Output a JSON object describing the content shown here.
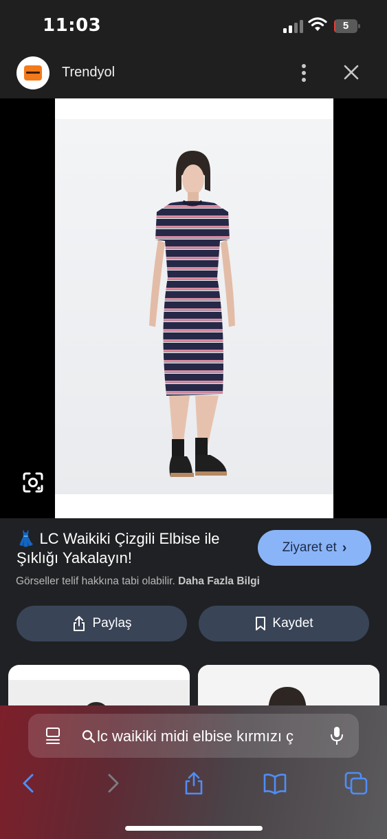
{
  "status_bar": {
    "time": "11:03",
    "battery_level": "5",
    "battery_fraction": 0.05
  },
  "header": {
    "site_name": "Trendyol",
    "logo_text": "trendyol"
  },
  "result": {
    "title": "👗 LC Waikiki Çizgili Elbise ile Şıklığı Yakalayın!",
    "visit_label": "Ziyaret et",
    "copyright_text": "Görseller telif hakkına tabi olabilir.",
    "learn_more": "Daha Fazla Bilgi",
    "share_label": "Paylaş",
    "save_label": "Kaydet"
  },
  "browser": {
    "address_text": "lc waikiki midi elbise kırmızı ç"
  },
  "colors": {
    "accent": "#8ab4f8",
    "button_bg": "#394457",
    "dress_navy": "#262847",
    "stripe_pink": "#d98aa0"
  }
}
